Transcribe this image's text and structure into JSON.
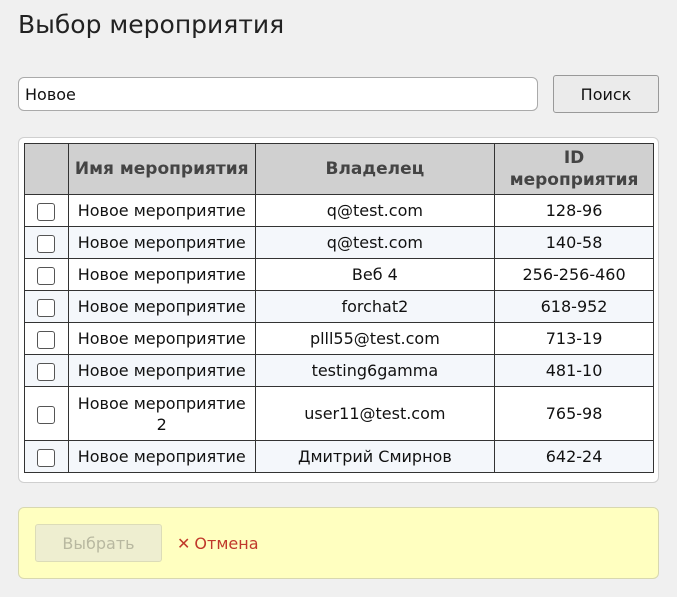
{
  "dialog": {
    "title": "Выбор мероприятия"
  },
  "search": {
    "value": "Новое",
    "button_label": "Поиск"
  },
  "table": {
    "headers": {
      "name": "Имя мероприятия",
      "owner": "Владелец",
      "id_line1": "ID",
      "id_line2": "мероприятия"
    },
    "rows": [
      {
        "name": "Новое мероприятие",
        "owner": "q@test.com",
        "id": "128-96"
      },
      {
        "name": "Новое мероприятие",
        "owner": "q@test.com",
        "id": "140-58"
      },
      {
        "name": "Новое мероприятие",
        "owner": "Веб 4",
        "id": "256-256-460"
      },
      {
        "name": "Новое мероприятие",
        "owner": "forchat2",
        "id": "618-952"
      },
      {
        "name": "Новое мероприятие",
        "owner": "plll55@test.com",
        "id": "713-19"
      },
      {
        "name": "Новое мероприятие",
        "owner": "testing6gamma",
        "id": "481-10"
      },
      {
        "name": "Новое мероприятие 2",
        "owner": "user11@test.com",
        "id": "765-98"
      },
      {
        "name": "Новое мероприятие",
        "owner": "Дмитрий Смирнов",
        "id": "642-24"
      }
    ]
  },
  "footer": {
    "select_label": "Выбрать",
    "cancel_label": "Отмена",
    "cancel_icon": "✕",
    "cancel_color": "#c0392b",
    "background_color": "#ffffc0"
  }
}
